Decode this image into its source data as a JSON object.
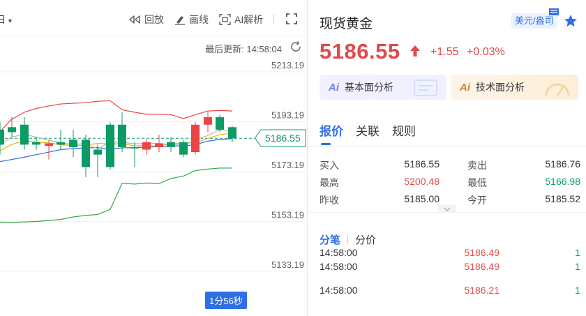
{
  "toolbar": {
    "period_label": "日",
    "replay_label": "回放",
    "draw_label": "画线",
    "ai_label": "AI解析"
  },
  "chart": {
    "last_update": "最后更新: 14:58:04",
    "y_ticks": [
      "5213.19",
      "5193.19",
      "5173.19",
      "5153.19",
      "5133.19"
    ],
    "current_price": "5186.55",
    "countdown": "1分56秒",
    "colors": {
      "up": "#e84545",
      "down": "#0c9b64",
      "ma_red": "#e84545",
      "ma_blue": "#2f6fe4",
      "ma_orange": "#f0b400",
      "ma_gray": "#b0b4ba",
      "band_green": "#33a844"
    }
  },
  "quote": {
    "title": "现货黄金",
    "unit_badge": "美元/盎司",
    "price": "5186.55",
    "change": "+1.55",
    "change_pct": "+0.03%",
    "ai_fundamental": "基本面分析",
    "ai_technical": "技术面分析",
    "ai_mark": "Ai",
    "tabs": [
      "报价",
      "关联",
      "规则"
    ],
    "stats": [
      {
        "label_left": "买入",
        "value_left": "5186.55",
        "left_color": "neutral",
        "label_right": "卖出",
        "value_right": "5186.76",
        "right_color": "neutral"
      },
      {
        "label_left": "最高",
        "value_left": "5200.48",
        "left_color": "up",
        "label_right": "最低",
        "value_right": "5166.98",
        "right_color": "down"
      },
      {
        "label_left": "昨收",
        "value_left": "5185.00",
        "left_color": "neutral",
        "label_right": "今开",
        "value_right": "5185.52",
        "right_color": "neutral"
      }
    ],
    "sub_tabs": [
      "分笔",
      "分价"
    ],
    "ticks": [
      {
        "time": "14:58:00",
        "price": "5186.49",
        "volume": "1"
      },
      {
        "time": "14:58:00",
        "price": "5186.21",
        "volume": "1"
      }
    ]
  }
}
